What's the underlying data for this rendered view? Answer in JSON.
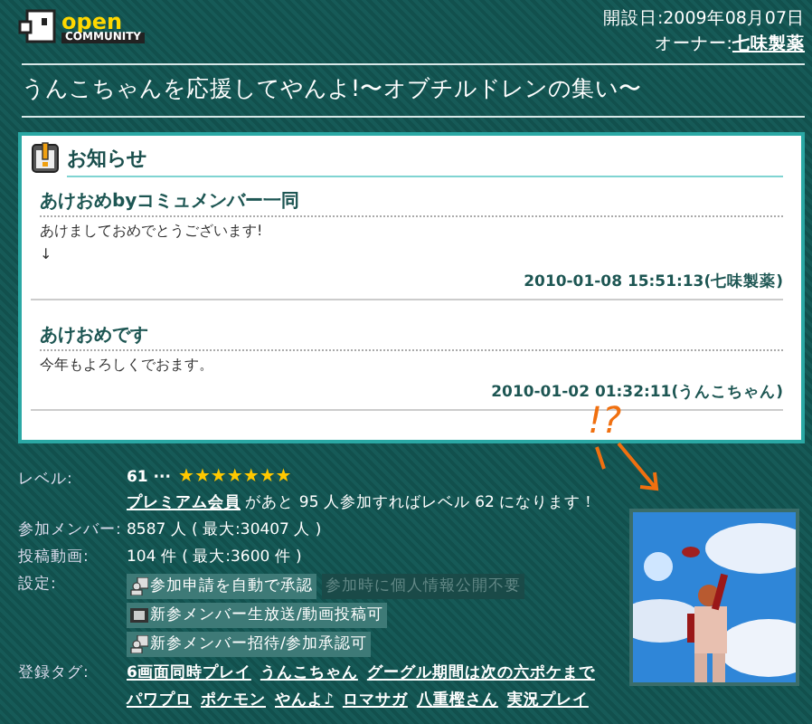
{
  "header": {
    "logo_top": "open",
    "logo_bottom": "COMMUNITY",
    "opened_label": "開設日:",
    "opened_date": "2009年08月07日",
    "owner_label": "オーナー:",
    "owner": "七味製薬"
  },
  "title": "うんこちゃんを応援してやんよ!〜オブチルドレンの集い〜",
  "notice": {
    "heading": "お知らせ",
    "posts": [
      {
        "title": "あけおめbyコミュメンバー一同",
        "lines": [
          "あけましておめでとうございます!",
          "↓"
        ],
        "footer": "2010-01-08 15:51:13(七味製薬)"
      },
      {
        "title": "あけおめです",
        "lines": [
          "今年もよろしくでおます。"
        ],
        "footer": "2010-01-02 01:32:11(うんこちゃん)"
      }
    ]
  },
  "annotation": "!?",
  "info": {
    "level_label": "レベル:",
    "level": "61 ···",
    "stars": 7,
    "level_note_link": "プレミアム会員",
    "level_note": "があと 95 人参加すればレベル 62 になります！",
    "members_label": "参加メンバー:",
    "members": "8587 人 ( 最大:30407 人 )",
    "videos_label": "投稿動画:",
    "videos": "104 件 ( 最大:3600 件 )",
    "settings_label": "設定:",
    "settings": [
      {
        "text": "参加申請を自動で承認",
        "on": true,
        "kind": "person"
      },
      {
        "text": "参加時に個人情報公開不要",
        "on": false,
        "kind": "none"
      },
      {
        "text": "新参メンバー生放送/動画投稿可",
        "on": true,
        "kind": "film"
      },
      {
        "text": "新参メンバー招待/参加承認可",
        "on": true,
        "kind": "person"
      }
    ],
    "tags_label": "登録タグ:",
    "tags": [
      "6画面同時プレイ",
      "うんこちゃん",
      "グーグル期間は次の六ポケまで",
      "パワプロ",
      "ポケモン",
      "やんよ♪",
      "ロマサガ",
      "八重樫さん",
      "実況プレイ"
    ]
  }
}
